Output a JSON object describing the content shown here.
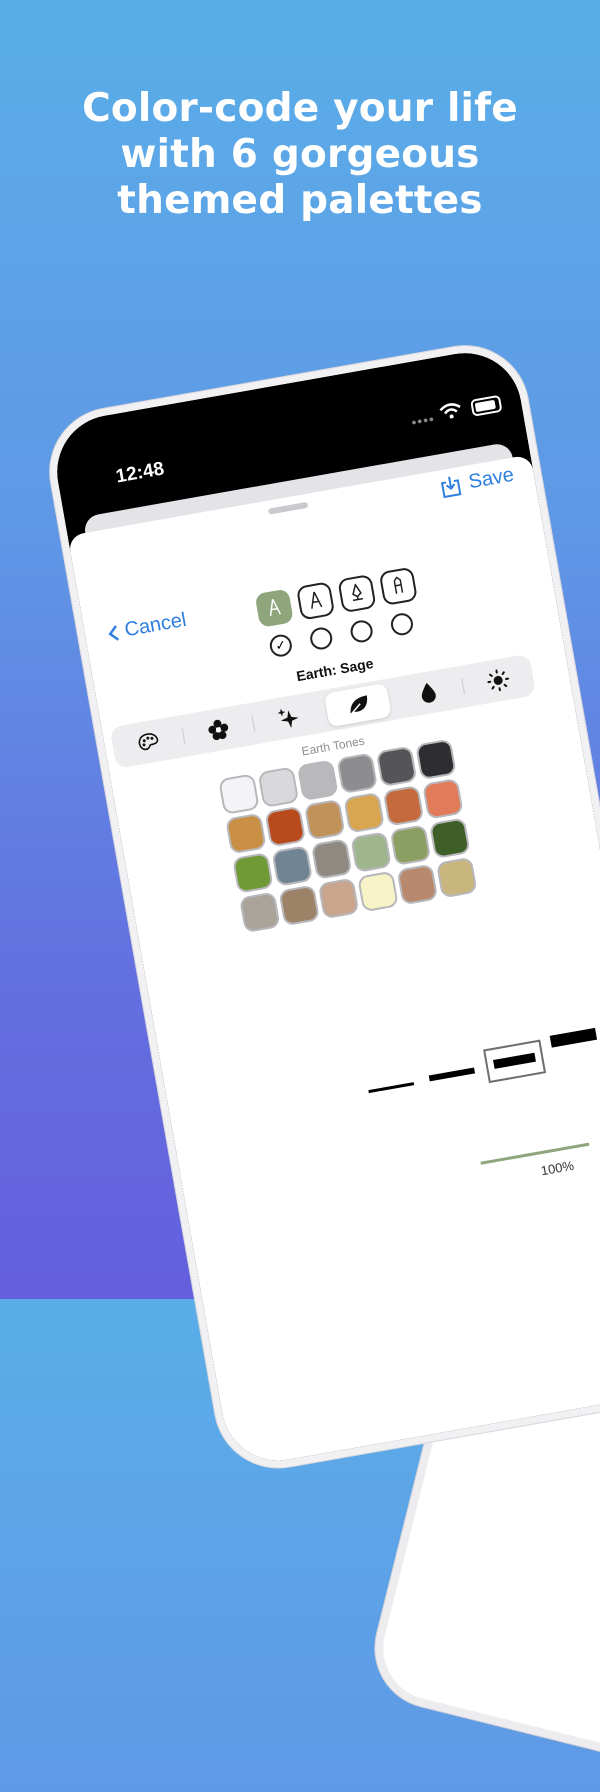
{
  "headline": {
    "line1": "Color-code your life",
    "line2": "with 6 gorgeous",
    "line3": "themed palettes"
  },
  "status_bar": {
    "time": "12:48",
    "signal_dots": "••••"
  },
  "nav": {
    "cancel_label": "Cancel",
    "save_label": "Save"
  },
  "tools": [
    {
      "icon": "pencil-tip-icon",
      "selected": true
    },
    {
      "icon": "marker-icon",
      "selected": false
    },
    {
      "icon": "pen-nib-icon",
      "selected": false
    },
    {
      "icon": "crayon-icon",
      "selected": false
    }
  ],
  "radio_checkmark": "✓",
  "palette_name": "Earth: Sage",
  "palette_tabs": [
    {
      "icon": "palette-icon"
    },
    {
      "icon": "flower-icon"
    },
    {
      "icon": "sparkles-icon"
    },
    {
      "icon": "leaf-icon",
      "selected": true
    },
    {
      "icon": "drop-icon"
    },
    {
      "icon": "sun-icon"
    }
  ],
  "group_label": "Earth Tones",
  "swatches": [
    "#f4f4f7",
    "#d9d9dc",
    "#b9b9bc",
    "#8d8d8f",
    "#555557",
    "#2e2e30",
    "#c98f44",
    "#b84a1c",
    "#c1925a",
    "#d8a550",
    "#c56a3c",
    "#e27b5a",
    "#6f9a35",
    "#718494",
    "#8f8a80",
    "#9eb58e",
    "#8b9f62",
    "#3f5f28",
    "#a9a39a",
    "#9c8266",
    "#c8a58c",
    "#f7f3c6",
    "#b8896e",
    "#c8b67e"
  ],
  "zoom_label": "100%",
  "colors": {
    "accent": "#2f7fe0",
    "selected_tool": "#8fa67d"
  }
}
